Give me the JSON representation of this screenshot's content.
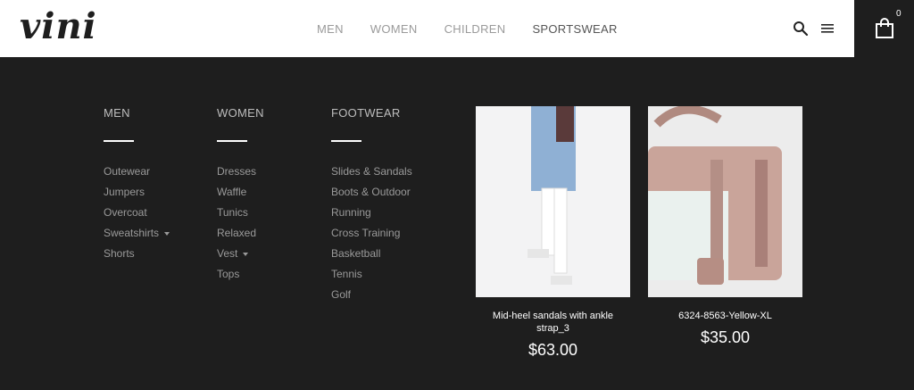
{
  "brand": {
    "logo": "vini"
  },
  "nav": {
    "items": [
      "MEN",
      "WOMEN",
      "CHILDREN",
      "SPORTSWEAR"
    ],
    "active": "SPORTSWEAR"
  },
  "header": {
    "search_icon": "search-icon",
    "menu_icon": "hamburger-icon",
    "cart_icon": "shopping-bag-icon",
    "cart_count": "0"
  },
  "mega_menu": {
    "columns": [
      {
        "title": "MEN",
        "items": [
          "Outewear",
          "Jumpers",
          "Overcoat",
          "Sweatshirts",
          "Shorts"
        ]
      },
      {
        "title": "WOMEN",
        "items": [
          "Dresses",
          "Waffle",
          "Tunics",
          "Relaxed",
          "Vest",
          "Tops"
        ]
      },
      {
        "title": "FOOTWEAR",
        "items": [
          "Slides & Sandals",
          "Boots & Outdoor",
          "Running",
          "Cross Training",
          "Basketball",
          "Tennis",
          "Golf"
        ]
      }
    ],
    "products": [
      {
        "name": "Mid-heel sandals with ankle strap_3",
        "price": "$63.00"
      },
      {
        "name": "6324-8563-Yellow-XL",
        "price": "$35.00"
      }
    ]
  },
  "colors": {
    "background": "#1e1e1e",
    "header": "#ffffff",
    "text_muted": "#9a9a9a"
  }
}
